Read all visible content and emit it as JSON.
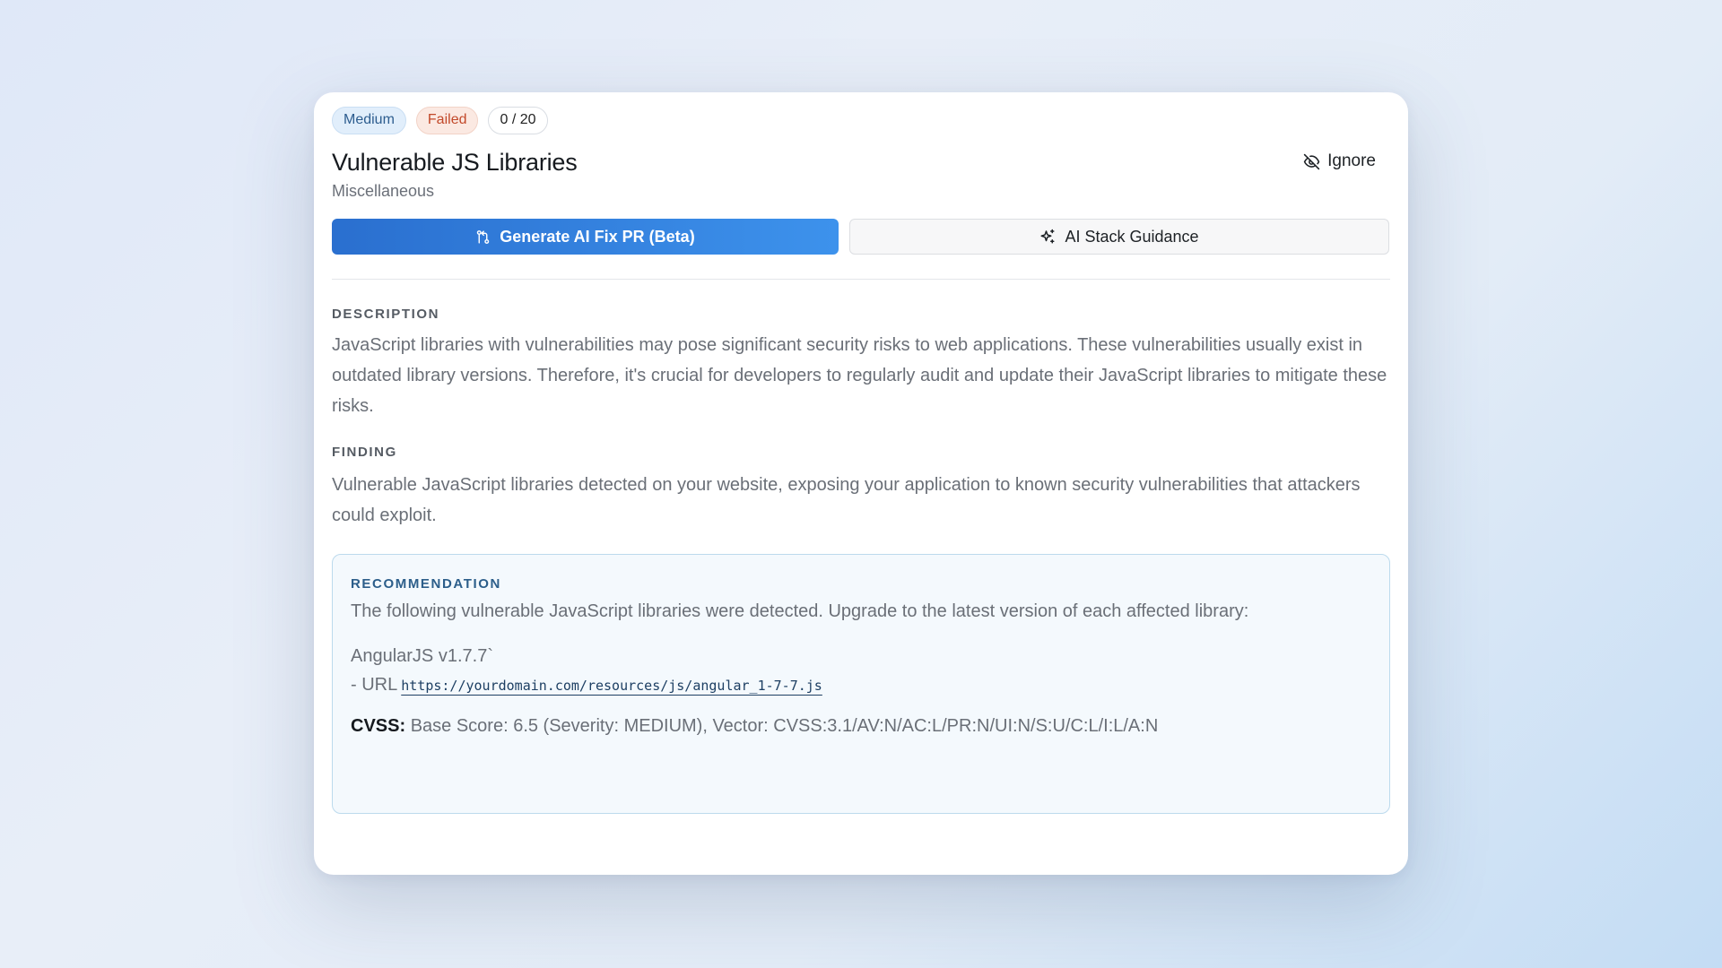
{
  "badges": {
    "severity": "Medium",
    "status": "Failed",
    "score": "0 / 20"
  },
  "header": {
    "title": "Vulnerable JS Libraries",
    "category": "Miscellaneous",
    "ignore_label": "Ignore"
  },
  "actions": {
    "primary_label": "Generate AI Fix PR (Beta)",
    "secondary_label": "AI Stack Guidance"
  },
  "description": {
    "label": "DESCRIPTION",
    "text": "JavaScript libraries with vulnerabilities may pose significant security risks to web applications. These vulnerabilities usually exist in outdated library versions. Therefore, it's crucial for developers to regularly audit and update their JavaScript libraries to mitigate these risks."
  },
  "finding": {
    "label": "FINDING",
    "text": "Vulnerable JavaScript libraries detected on your website, exposing your application to known security vulnerabilities that attackers could exploit."
  },
  "recommendation": {
    "label": "RECOMMENDATION",
    "intro": "The following vulnerable JavaScript libraries were detected. Upgrade to the latest version of each affected library:",
    "library_name": "AngularJS v1.7.7`",
    "url_prefix": "- URL",
    "url": "https://yourdomain.com/resources/js/angular_1-7-7.js",
    "cvss_label": "CVSS:",
    "cvss_value": "Base Score: 6.5 (Severity: MEDIUM), Vector: CVSS:3.1/AV:N/AC:L/PR:N/UI:N/S:U/C:L/I:L/A:N"
  },
  "colors": {
    "primary_button_start": "#2a6fcf",
    "primary_button_end": "#3d92ec",
    "severity_badge": "#e1eefb",
    "status_badge": "#fbe9e2",
    "recommendation_bg": "#f4f9fd",
    "recommendation_border": "#bcdaed"
  },
  "icons": {
    "ignore": "eye-off-icon",
    "primary": "git-pull-request-icon",
    "secondary": "sparkles-icon"
  }
}
